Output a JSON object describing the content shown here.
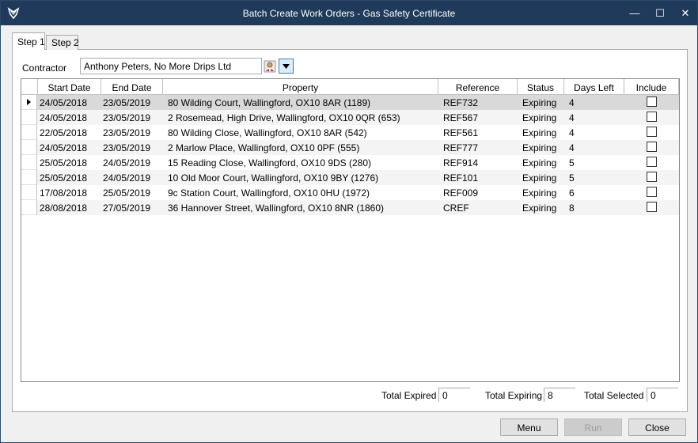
{
  "window": {
    "title": "Batch Create Work Orders - Gas Safety Certificate",
    "minimize_glyph": "—",
    "maximize_glyph": "☐",
    "close_glyph": "✕"
  },
  "tabs": [
    {
      "label": "Step 1",
      "active": true
    },
    {
      "label": "Step 2",
      "active": false
    }
  ],
  "contractor": {
    "label": "Contractor",
    "value": "Anthony Peters, No More Drips Ltd"
  },
  "grid": {
    "columns": [
      "Start Date",
      "End Date",
      "Property",
      "Reference",
      "Status",
      "Days Left",
      "Include"
    ],
    "rows": [
      {
        "start": "24/05/2018",
        "end": "23/05/2019",
        "property": "80 Wilding Court, Wallingford, OX10 8AR (1189)",
        "reference": "REF732",
        "status": "Expiring",
        "days_left": "4",
        "include": false
      },
      {
        "start": "24/05/2018",
        "end": "23/05/2019",
        "property": "2 Rosemead, High Drive, Wallingford, OX10 0QR (653)",
        "reference": "REF567",
        "status": "Expiring",
        "days_left": "4",
        "include": false
      },
      {
        "start": "22/05/2018",
        "end": "23/05/2019",
        "property": "80 Wilding Close, Wallingford, OX10 8AR (542)",
        "reference": "REF561",
        "status": "Expiring",
        "days_left": "4",
        "include": false
      },
      {
        "start": "24/05/2018",
        "end": "23/05/2019",
        "property": "2 Marlow Place, Wallingford, OX10 0PF (555)",
        "reference": "REF777",
        "status": "Expiring",
        "days_left": "4",
        "include": false
      },
      {
        "start": "25/05/2018",
        "end": "24/05/2019",
        "property": "15 Reading Close, Wallingford, OX10 9DS (280)",
        "reference": "REF914",
        "status": "Expiring",
        "days_left": "5",
        "include": false
      },
      {
        "start": "25/05/2018",
        "end": "24/05/2019",
        "property": "10 Old Moor Court, Wallingford, OX10 9BY (1276)",
        "reference": "REF101",
        "status": "Expiring",
        "days_left": "5",
        "include": false
      },
      {
        "start": "17/08/2018",
        "end": "25/05/2019",
        "property": "9c Station Court, Wallingford, OX10 0HU (1972)",
        "reference": "REF009",
        "status": "Expiring",
        "days_left": "6",
        "include": false
      },
      {
        "start": "28/08/2018",
        "end": "27/05/2019",
        "property": "36 Hannover Street, Wallingford, OX10 8NR (1860)",
        "reference": "CREF",
        "status": "Expiring",
        "days_left": "8",
        "include": false
      }
    ]
  },
  "totals": {
    "expired_label": "Total Expired",
    "expired_value": "0",
    "expiring_label": "Total Expiring",
    "expiring_value": "8",
    "selected_label": "Total Selected",
    "selected_value": "0"
  },
  "buttons": {
    "menu": "Menu",
    "run": "Run",
    "close": "Close"
  },
  "icons": {
    "app": "app-logo-icon",
    "contractor_lookup": "person-icon",
    "dropdown": "chevron-down-icon"
  }
}
